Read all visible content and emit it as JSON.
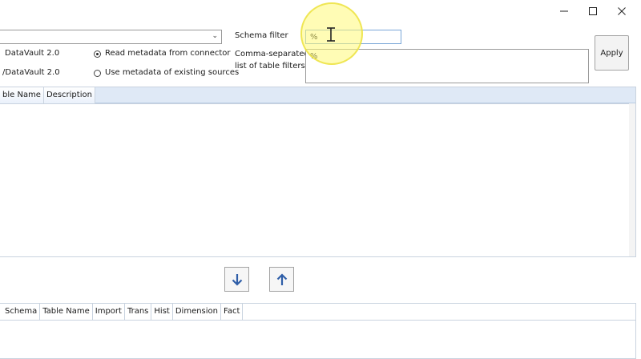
{
  "window": {
    "buttons": {
      "minimize": "—",
      "maximize": "☐",
      "close": "✕"
    }
  },
  "connector": {
    "selected": ""
  },
  "labels": {
    "dv1": "DataVault 2.0",
    "dv2": "/DataVault 2.0",
    "schema_filter": "Schema filter",
    "table_filters_line1": "Comma-separated",
    "table_filters_line2": "list of table filters"
  },
  "radios": [
    {
      "label": "Read metadata from connector",
      "checked": true
    },
    {
      "label": "Use metadata of existing sources",
      "checked": false
    }
  ],
  "schema_filter": {
    "value": "%"
  },
  "table_filters": {
    "value": "%"
  },
  "apply": {
    "label": "Apply"
  },
  "upper_grid": {
    "columns": [
      "ble Name",
      "Description"
    ]
  },
  "lower_grid": {
    "columns": [
      "Schema",
      "Table Name",
      "Import",
      "Trans",
      "Hist",
      "Dimension",
      "Fact"
    ]
  },
  "colors": {
    "accent_blue": "#2f5ea8",
    "grid_border": "#c9d3df",
    "highlight": "#fffa78"
  },
  "icons": {
    "move_down": "arrow-down-icon",
    "move_up": "arrow-up-icon"
  }
}
